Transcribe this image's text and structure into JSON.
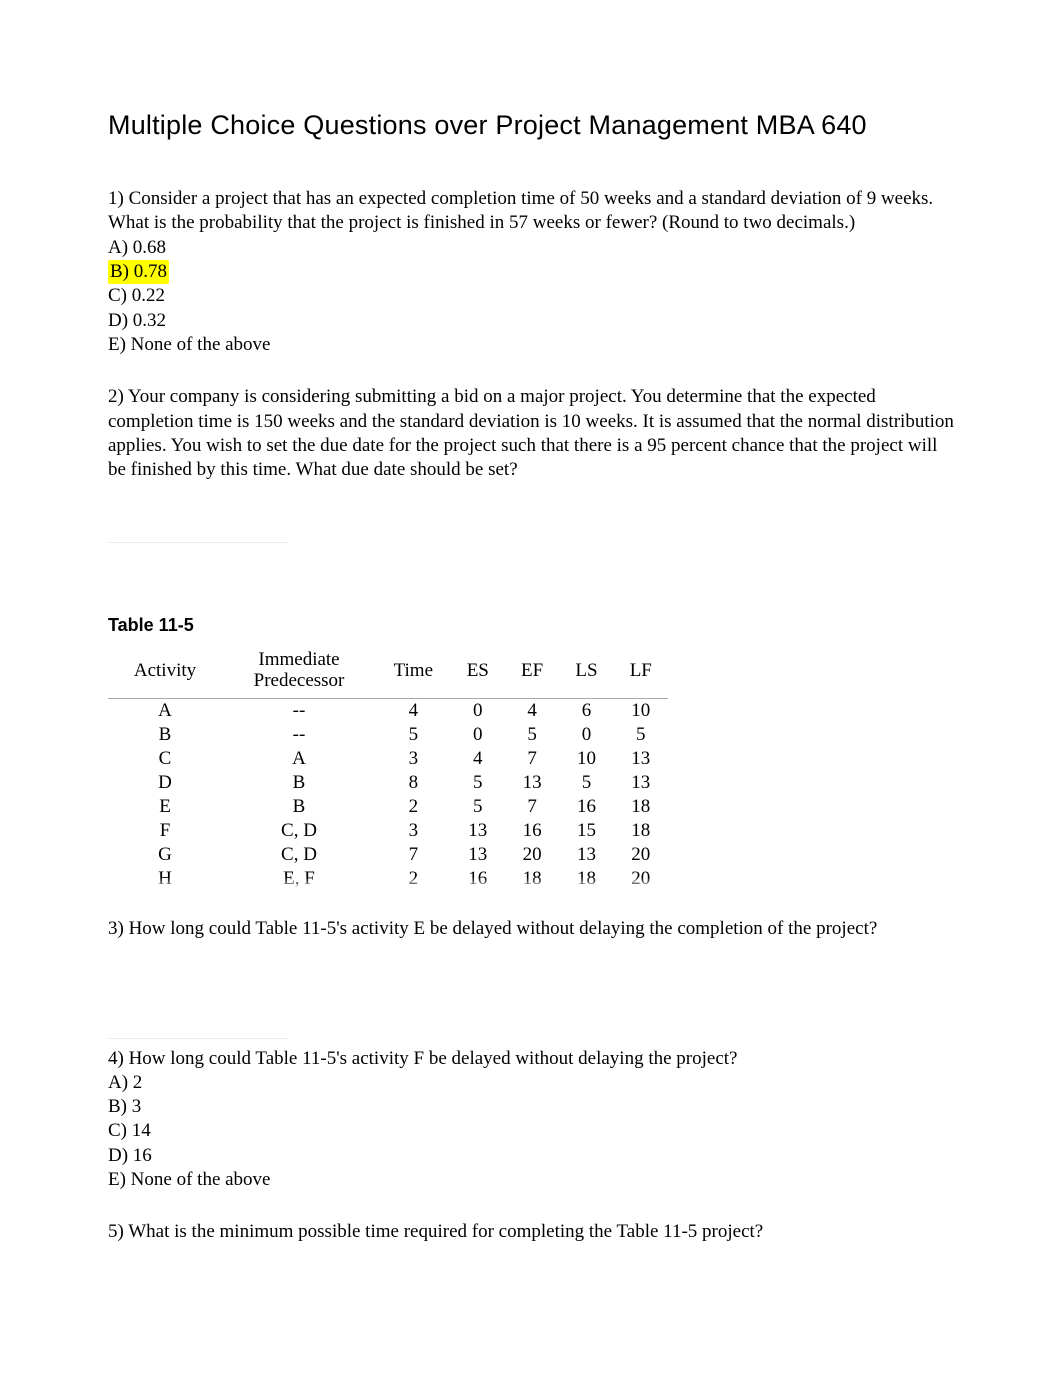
{
  "title": "Multiple Choice Questions over Project Management   MBA 640",
  "q1": {
    "prompt": "1) Consider a project that has an expected completion time of 50 weeks and a standard deviation of 9 weeks. What is the probability that the project is finished in 57 weeks or fewer? (Round to two decimals.)",
    "options": {
      "a": "A) 0.68",
      "b": "B) 0.78",
      "c": "C) 0.22",
      "d": "D) 0.32",
      "e": "E) None of the above"
    },
    "highlighted": "b"
  },
  "q2": {
    "prompt": "2) Your company is considering submitting a bid on a major project. You determine that the expected completion time is 150 weeks and the standard deviation is 10 weeks. It is assumed that the normal distribution applies. You wish to set the due date for the project such that there is a 95 percent chance that the project will be finished by this time. What due date should be set?"
  },
  "table_label": "Table 11-5",
  "chart_data": {
    "type": "table",
    "title": "Table 11-5",
    "columns": [
      "Activity",
      "Immediate Predecessor",
      "Time",
      "ES",
      "EF",
      "LS",
      "LF"
    ],
    "rows": [
      {
        "activity": "A",
        "predecessor": "--",
        "time": 4,
        "es": 0,
        "ef": 4,
        "ls": 6,
        "lf": 10
      },
      {
        "activity": "B",
        "predecessor": "--",
        "time": 5,
        "es": 0,
        "ef": 5,
        "ls": 0,
        "lf": 5
      },
      {
        "activity": "C",
        "predecessor": "A",
        "time": 3,
        "es": 4,
        "ef": 7,
        "ls": 10,
        "lf": 13
      },
      {
        "activity": "D",
        "predecessor": "B",
        "time": 8,
        "es": 5,
        "ef": 13,
        "ls": 5,
        "lf": 13
      },
      {
        "activity": "E",
        "predecessor": "B",
        "time": 2,
        "es": 5,
        "ef": 7,
        "ls": 16,
        "lf": 18
      },
      {
        "activity": "F",
        "predecessor": "C, D",
        "time": 3,
        "es": 13,
        "ef": 16,
        "ls": 15,
        "lf": 18
      },
      {
        "activity": "G",
        "predecessor": "C, D",
        "time": 7,
        "es": 13,
        "ef": 20,
        "ls": 13,
        "lf": 20
      },
      {
        "activity": "H",
        "predecessor": "E, F",
        "time": 2,
        "es": 16,
        "ef": 18,
        "ls": 18,
        "lf": 20
      }
    ]
  },
  "q3": {
    "prompt": "3) How long could Table 11-5's activity E be delayed without delaying the completion of the project?"
  },
  "q4": {
    "prompt": "4) How long could Table 11-5's activity F be delayed without delaying the project?",
    "options": {
      "a": "A) 2",
      "b": "B) 3",
      "c": "C) 14",
      "d": "D) 16",
      "e": "E) None of the above"
    }
  },
  "q5": {
    "prompt": "5) What is the minimum possible time required for completing the Table 11-5 project?"
  }
}
